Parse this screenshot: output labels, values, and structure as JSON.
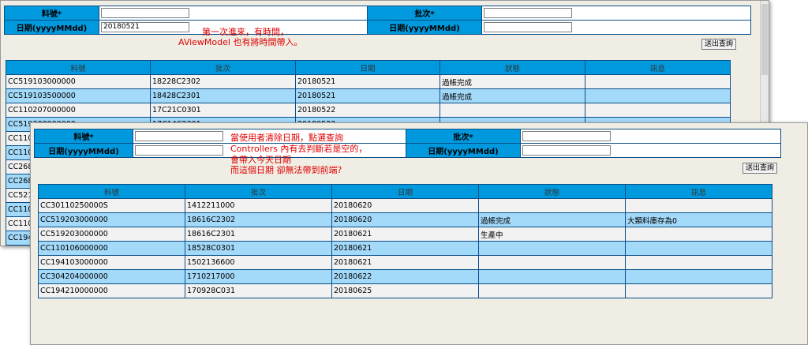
{
  "panel_back": {
    "form": {
      "material_label": "料號*",
      "material_value": "",
      "batch_label": "批次*",
      "batch_value": "",
      "date_label": "日期(yyyyMMdd)",
      "date_value": "20180521",
      "date2_label": "日期(yyyyMMdd)",
      "date2_value": ""
    },
    "note_line1": "第一次進來，有時間，",
    "note_line2": "AViewModel  也有將時間帶入。",
    "submit_label": "送出查詢",
    "table": {
      "headers": [
        "料號",
        "批次",
        "日期",
        "狀態",
        "訊息"
      ],
      "rows": [
        [
          "CC519103000000",
          "18228C2302",
          "20180521",
          "過帳完成",
          ""
        ],
        [
          "CC519103500000",
          "18428C2301",
          "20180521",
          "過帳完成",
          ""
        ],
        [
          "CC110207000000",
          "17C21C0301",
          "20180522",
          "",
          ""
        ],
        [
          "CC519308000000",
          "17C14C2301",
          "20180522",
          "",
          ""
        ],
        [
          "CC110",
          "",
          "",
          "",
          ""
        ],
        [
          "CC110",
          "",
          "",
          "",
          ""
        ],
        [
          "CC268",
          "",
          "",
          "",
          ""
        ],
        [
          "CC268",
          "",
          "",
          "",
          ""
        ],
        [
          "CC521",
          "",
          "",
          "",
          ""
        ],
        [
          "CC110",
          "",
          "",
          "",
          ""
        ],
        [
          "CC110",
          "",
          "",
          "",
          ""
        ],
        [
          "CC194",
          "",
          "",
          "",
          ""
        ]
      ]
    }
  },
  "panel_front": {
    "form": {
      "material_label": "料號*",
      "material_value": "",
      "batch_label": "批次*",
      "batch_value": "",
      "date_label": "日期(yyyyMMdd)",
      "date_value": "",
      "date2_label": "日期(yyyyMMdd)",
      "date2_value": ""
    },
    "note_line1": "當使用者清除日期，點選查詢",
    "note_line2": "Controllers 內有去判斷若是空的，",
    "note_line3": "會帶入今天日期",
    "note_line4": "而這個日期 卻無法帶到前端?",
    "submit_label": "送出查詢",
    "table": {
      "headers": [
        "料號",
        "批次",
        "日期",
        "狀態",
        "訊息"
      ],
      "rows": [
        [
          "CC30110250000S",
          "1412211000",
          "20180620",
          "",
          ""
        ],
        [
          "CC519203000000",
          "18616C2302",
          "20180620",
          "過帳完成",
          "大類料庫存為0"
        ],
        [
          "CC519203000000",
          "18616C2301",
          "20180621",
          "生產中",
          ""
        ],
        [
          "CC110106000000",
          "18528C0301",
          "20180621",
          "",
          ""
        ],
        [
          "CC194103000000",
          "1502136600",
          "20180621",
          "",
          ""
        ],
        [
          "CC304204000000",
          "1710217000",
          "20180622",
          "",
          ""
        ],
        [
          "CC194210000000",
          "170928C031",
          "20180625",
          "",
          ""
        ]
      ]
    }
  },
  "colors": {
    "header_blue": "#0099dd",
    "row_blue": "#a3d9f9",
    "row_gray": "#f2f2f2",
    "annotation_red": "#e00000",
    "panel_bg": "#f0eee4"
  }
}
